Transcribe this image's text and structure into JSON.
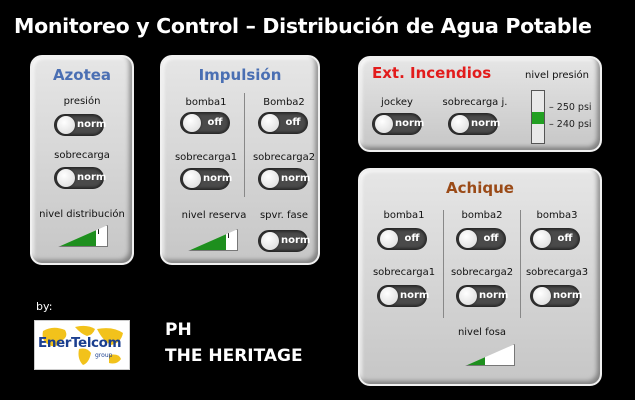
{
  "title": "Monitoreo y Control – Distribución de Agua Potable",
  "azotea": {
    "title": "Azotea",
    "presion_label": "presión",
    "presion_state": "norm",
    "sobrecarga_label": "sobrecarga",
    "sobrecarga_state": "norm",
    "nivel_label": "nivel distribución",
    "nivel_level": 0.78
  },
  "impulsion": {
    "title": "Impulsión",
    "bomba1_label": "bomba1",
    "bomba1_state": "off",
    "bomba2_label": "Bomba2",
    "bomba2_state": "off",
    "sobrecarga1_label": "sobrecarga1",
    "sobrecarga1_state": "norm",
    "sobrecarga2_label": "sobrecarga2",
    "sobrecarga2_state": "norm",
    "nivel_label": "nivel reserva",
    "nivel_level": 0.78,
    "spvr_label": "spvr. fase",
    "spvr_state": "norm"
  },
  "incendios": {
    "title": "Ext. Incendios",
    "jockey_label": "jockey",
    "jockey_state": "norm",
    "sobrecarga_label": "sobrecarga j.",
    "sobrecarga_state": "norm",
    "presion_label": "nivel presión",
    "psi_high": "250 psi",
    "psi_low": "240 psi"
  },
  "achique": {
    "title": "Achique",
    "bomba1_label": "bomba1",
    "bomba1_state": "off",
    "bomba2_label": "bomba2",
    "bomba2_state": "off",
    "bomba3_label": "bomba3",
    "bomba3_state": "off",
    "sobrecarga1_label": "sobrecarga1",
    "sobrecarga1_state": "norm",
    "sobrecarga2_label": "sobrecarga2",
    "sobrecarga2_state": "norm",
    "sobrecarga3_label": "sobrecarga3",
    "sobrecarga3_state": "norm",
    "nivel_label": "nivel fosa",
    "nivel_level": 0.4
  },
  "footer": {
    "by_label": "by:",
    "logo_text": "EnerTelcom",
    "logo_sub": "group",
    "site_code": "PH",
    "site_name": "THE HERITAGE"
  },
  "colors": {
    "level_fill": "#1e8f1e",
    "gauge_band": "#22a022",
    "toggle_bg": "#4a4a4a"
  }
}
